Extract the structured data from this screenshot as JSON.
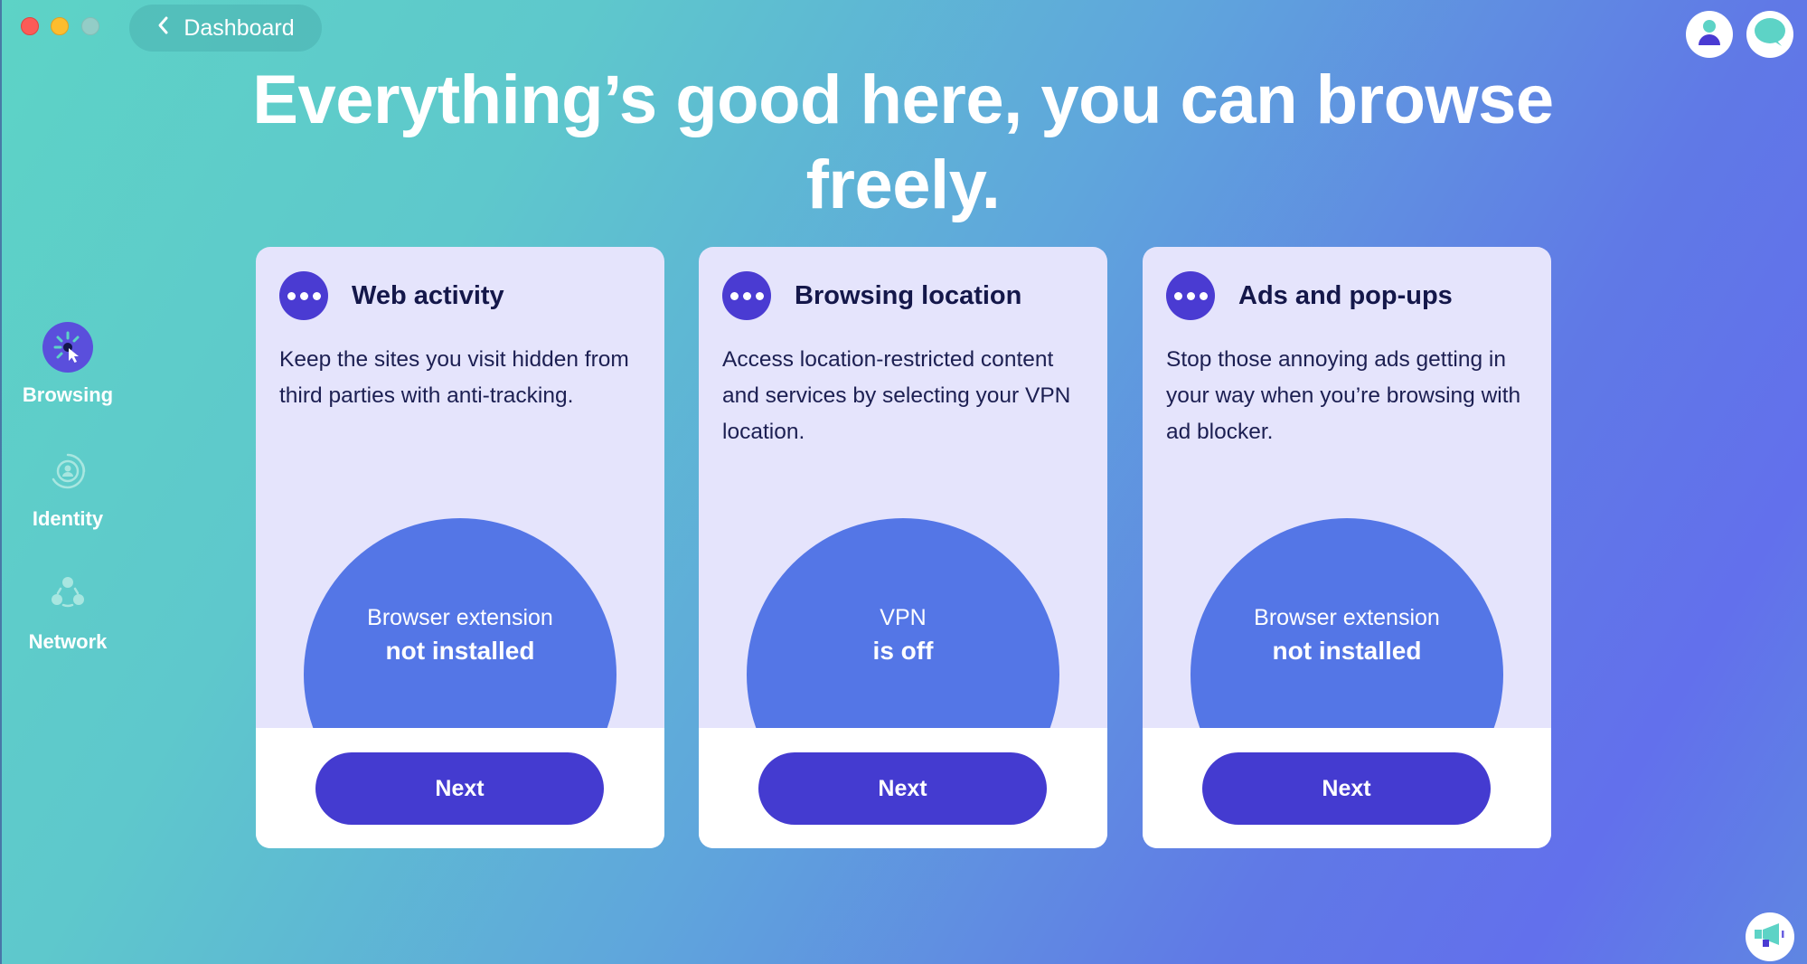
{
  "window": {
    "controls": [
      "close",
      "minimize",
      "zoom"
    ]
  },
  "nav": {
    "back_label": "Dashboard",
    "back_icon": "chevron-left-icon"
  },
  "top_right": {
    "account_icon": "account-icon",
    "chat_icon": "chat-bubble-icon"
  },
  "headline": "Everything’s good here, you can browse freely.",
  "sidebar": {
    "items": [
      {
        "label": "Browsing",
        "icon": "browsing-cursor-icon",
        "active": true
      },
      {
        "label": "Identity",
        "icon": "identity-icon",
        "active": false
      },
      {
        "label": "Network",
        "icon": "network-icon",
        "active": false
      }
    ]
  },
  "cards": [
    {
      "title": "Web activity",
      "description": "Keep the sites you visit hidden from third parties with anti-tracking.",
      "status_line1": "Browser extension",
      "status_line2": "not installed",
      "button_label": "Next"
    },
    {
      "title": "Browsing location",
      "description": "Access location-restricted content and services by selecting your VPN location.",
      "status_line1": "VPN",
      "status_line2": "is off",
      "button_label": "Next"
    },
    {
      "title": "Ads and pop-ups",
      "description": "Stop those annoying ads getting in your way when you’re browsing with ad blocker.",
      "status_line1": "Browser extension",
      "status_line2": "not installed",
      "button_label": "Next"
    }
  ],
  "footer": {
    "announcement_icon": "megaphone-icon"
  },
  "colors": {
    "accent": "#443bd0",
    "status_circle": "#5476e6",
    "card_bg": "#e5e4fc",
    "title_text": "#14174a",
    "teal": "#5dd3c6"
  }
}
